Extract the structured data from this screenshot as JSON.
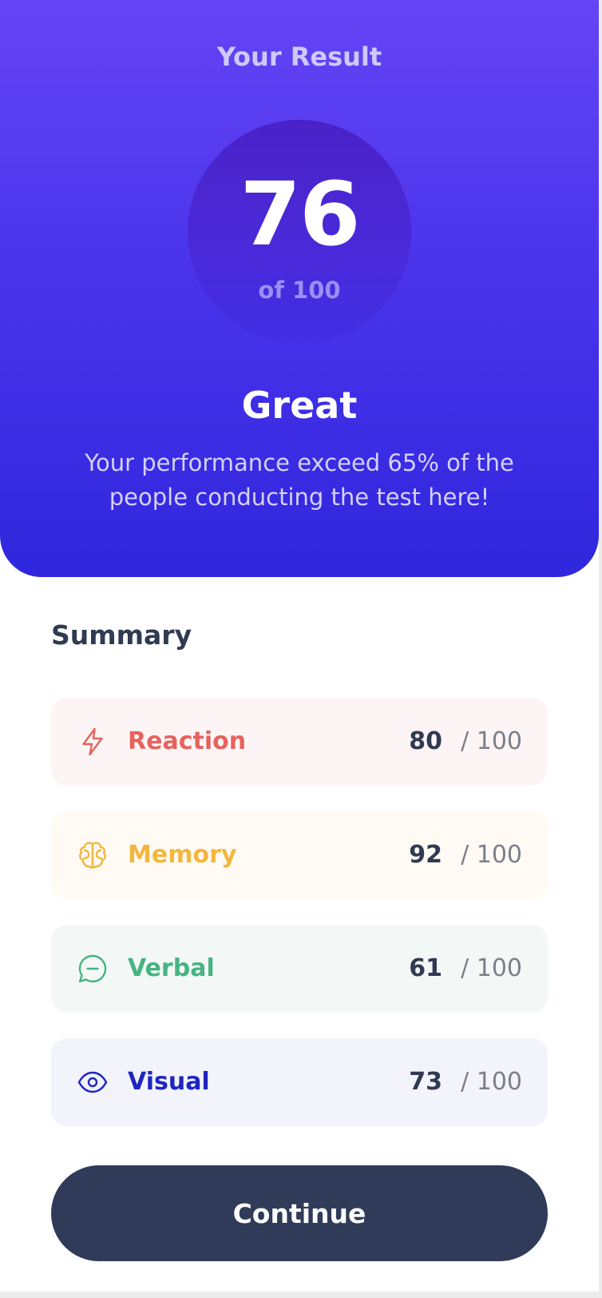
{
  "header": {
    "title": "Your Result",
    "score": "76",
    "score_of": "of 100",
    "rating": "Great",
    "description": "Your performance exceed 65% of the people conducting the test here!"
  },
  "summary": {
    "title": "Summary",
    "items": [
      {
        "label": "Reaction",
        "score": "80",
        "total": "/ 100",
        "icon": "lightning-icon",
        "color": "#e5635e",
        "background": "#fdf5f5"
      },
      {
        "label": "Memory",
        "score": "92",
        "total": "/ 100",
        "icon": "brain-icon",
        "color": "#f3b63e",
        "background": "#fffbf4"
      },
      {
        "label": "Verbal",
        "score": "61",
        "total": "/ 100",
        "icon": "chat-bubble-icon",
        "color": "#46b482",
        "background": "#f3f8f6"
      },
      {
        "label": "Visual",
        "score": "73",
        "total": "/ 100",
        "icon": "eye-icon",
        "color": "#1f25c1",
        "background": "#f2f3fb"
      }
    ]
  },
  "actions": {
    "continue_label": "Continue"
  },
  "colors": {
    "hero_top": "#6545f5",
    "hero_bottom": "#2f27dd",
    "button": "#303b59",
    "heading": "#303a52"
  }
}
